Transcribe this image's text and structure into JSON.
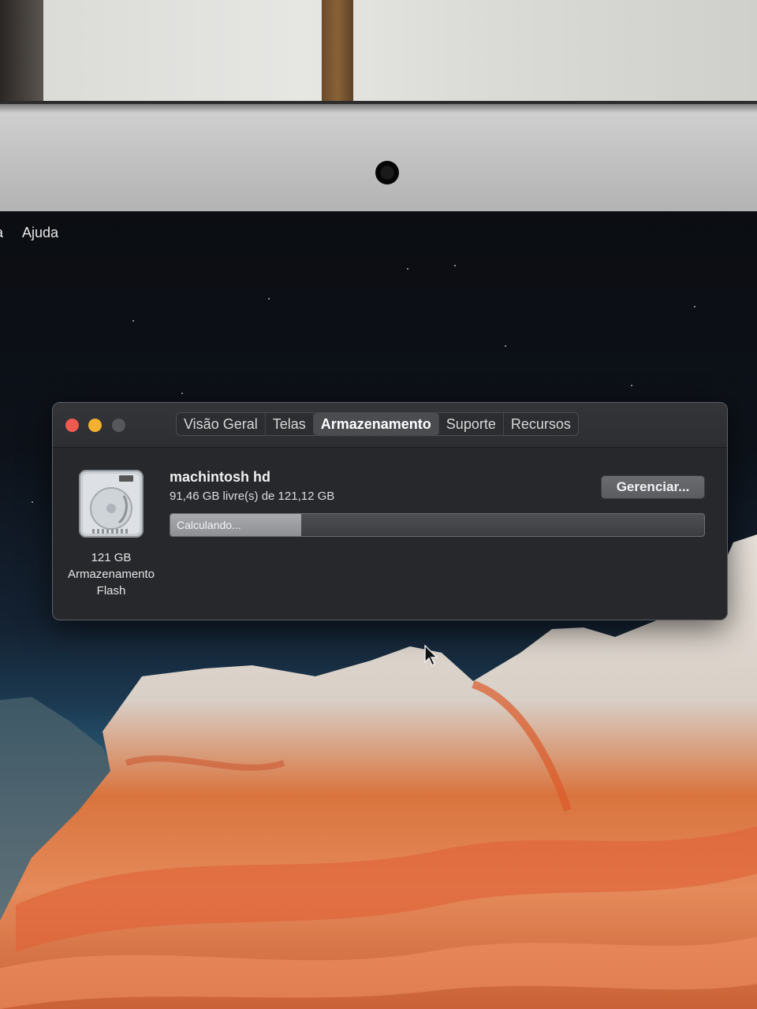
{
  "menubar": {
    "partial_item": "a",
    "help": "Ajuda"
  },
  "window": {
    "tabs": [
      {
        "label": "Visão Geral",
        "active": false
      },
      {
        "label": "Telas",
        "active": false
      },
      {
        "label": "Armazenamento",
        "active": true
      },
      {
        "label": "Suporte",
        "active": false
      },
      {
        "label": "Recursos",
        "active": false
      }
    ],
    "disk": {
      "caption_size": "121 GB",
      "caption_line2": "Armazenamento",
      "caption_line3": "Flash",
      "name": "machintosh hd",
      "free_text": "91,46 GB livre(s) de 121,12 GB",
      "usage_fraction": 0.245,
      "bar_label": "Calculando...",
      "icon": "hard-drive-icon"
    },
    "manage_button": "Gerenciar..."
  },
  "colors": {
    "close": "#ee5a4f",
    "minimize": "#f3b12f",
    "zoom_inactive": "#55575a",
    "window_bg": "#26282b"
  }
}
